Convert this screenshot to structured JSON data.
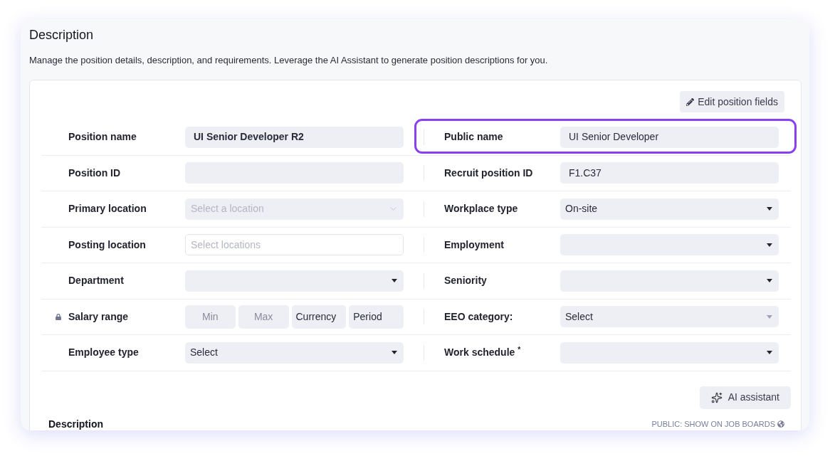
{
  "section": {
    "title": "Description",
    "subtitle": "Manage the position details, description, and requirements. Leverage the AI Assistant to generate position descriptions for you."
  },
  "edit_button": {
    "label": "Edit position fields"
  },
  "rows": [
    {
      "left": {
        "kind": "text",
        "label": "Position name",
        "value": "UI Senior Developer R2",
        "bold": true,
        "locked": false,
        "highlighted": false
      },
      "right": {
        "kind": "text",
        "label": "Public name",
        "value": "UI Senior Developer",
        "bold": false,
        "locked": false,
        "highlighted": true
      }
    },
    {
      "left": {
        "kind": "text",
        "label": "Position ID",
        "locked": false,
        "highlighted": false
      },
      "right": {
        "kind": "text",
        "label": "Recruit position ID",
        "value": "F1.C37",
        "bold": false,
        "locked": false,
        "highlighted": false
      }
    },
    {
      "left": {
        "kind": "location",
        "label": "Primary location",
        "placeholder": "Select a location",
        "locked": false,
        "highlighted": false
      },
      "right": {
        "kind": "select",
        "label": "Workplace type",
        "value": "On-site",
        "bold": false,
        "disabled": false,
        "locked": false,
        "highlighted": false
      }
    },
    {
      "left": {
        "kind": "multiselect",
        "label": "Posting location",
        "placeholder": "Select locations",
        "locked": false,
        "highlighted": false
      },
      "right": {
        "kind": "select",
        "label": "Employment",
        "disabled": false,
        "locked": false,
        "highlighted": false
      }
    },
    {
      "left": {
        "kind": "select",
        "label": "Department",
        "disabled": false,
        "locked": false,
        "highlighted": false
      },
      "right": {
        "kind": "select",
        "label": "Seniority",
        "disabled": false,
        "locked": false,
        "highlighted": false
      }
    },
    {
      "left": {
        "kind": "range",
        "label": "Salary range",
        "locked": true,
        "highlighted": false,
        "parts": [
          {
            "kind": "input",
            "placeholder": "Min"
          },
          {
            "kind": "input",
            "placeholder": "Max"
          },
          {
            "kind": "select",
            "value": "Currency"
          },
          {
            "kind": "select",
            "value": "Period"
          }
        ]
      },
      "right": {
        "kind": "select",
        "label": "EEO category:",
        "value": "Select",
        "bold": false,
        "disabled": true,
        "locked": false,
        "highlighted": false
      }
    },
    {
      "left": {
        "kind": "select",
        "label": "Employee type",
        "value": "Select",
        "bold": false,
        "disabled": false,
        "locked": false,
        "highlighted": false
      },
      "right": {
        "kind": "select",
        "label": "Work schedule $^{*}$",
        "disabled": false,
        "locked": false,
        "highlighted": false
      }
    }
  ],
  "ai_button": {
    "label": "AI assistant"
  },
  "description": {
    "heading": "Description",
    "visibility": "PUBLIC: SHOW ON JOB BOARDS"
  }
}
